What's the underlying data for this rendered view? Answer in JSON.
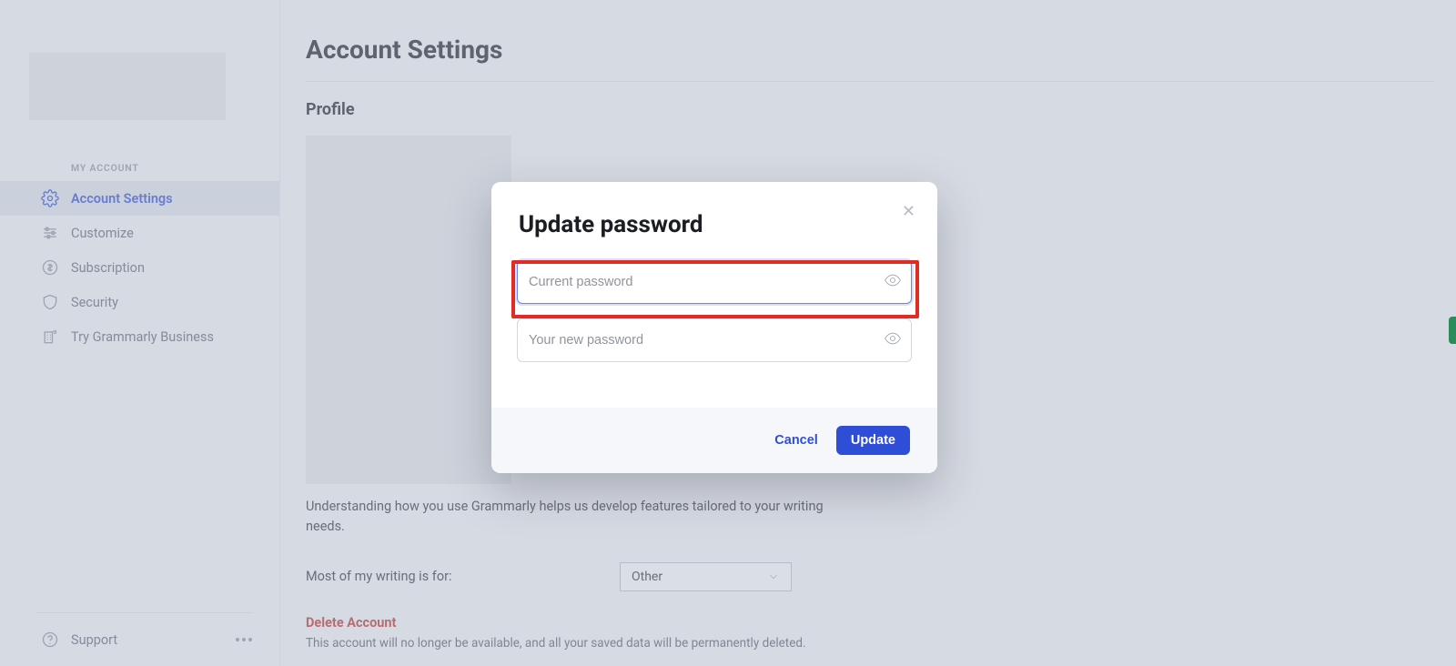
{
  "sidebar": {
    "heading": "MY ACCOUNT",
    "items": [
      {
        "label": "Account Settings"
      },
      {
        "label": "Customize"
      },
      {
        "label": "Subscription"
      },
      {
        "label": "Security"
      },
      {
        "label": "Try Grammarly Business"
      }
    ],
    "support_label": "Support"
  },
  "main": {
    "page_title": "Account Settings",
    "section_profile": "Profile",
    "hint": "Understanding how you use Grammarly helps us develop features tailored to your writing needs.",
    "writing_label": "Most of my writing is for:",
    "writing_value": "Other",
    "delete_title": "Delete Account",
    "delete_text": "This account will no longer be available, and all your saved data will be permanently deleted."
  },
  "modal": {
    "title": "Update password",
    "current_placeholder": "Current password",
    "new_placeholder": "Your new password",
    "cancel_label": "Cancel",
    "update_label": "Update"
  }
}
